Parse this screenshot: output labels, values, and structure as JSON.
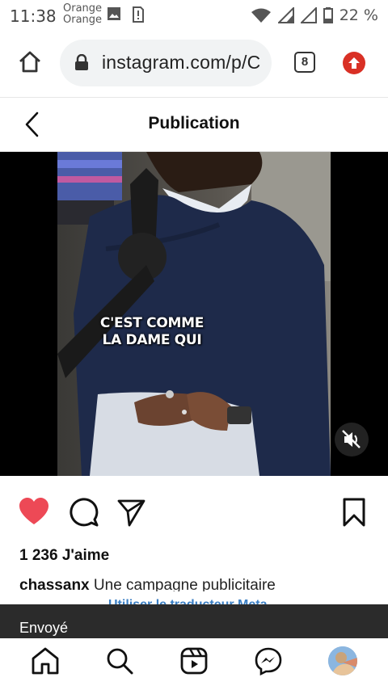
{
  "status_bar": {
    "time": "11:38",
    "carrier_line1": "Orange",
    "carrier_line2": "Orange",
    "battery": "22 %",
    "icons": [
      "image-icon",
      "sim-alert-icon",
      "wifi-icon",
      "signal-icon",
      "signal-icon",
      "battery-icon"
    ]
  },
  "browser": {
    "url": "instagram.com/p/C",
    "tab_count": "8",
    "icons": [
      "home-icon",
      "lock-icon",
      "tabs-icon",
      "update-icon"
    ]
  },
  "header": {
    "title": "Publication"
  },
  "video": {
    "caption_line1": "C'EST COMME",
    "caption_line2": "LA DAME QUI",
    "muted": true
  },
  "post": {
    "likes": "1 236 J'aime",
    "caption_user": "chassanx",
    "caption_text": " Une campagne publicitaire",
    "translate_link": "Utiliser le traducteur Meta"
  },
  "toast": {
    "text": "Envoyé"
  },
  "colors": {
    "like_red": "#ed4956",
    "update_red": "#d93025",
    "link_blue": "#3b7fc4",
    "toast_bg": "#2b2b2b"
  }
}
